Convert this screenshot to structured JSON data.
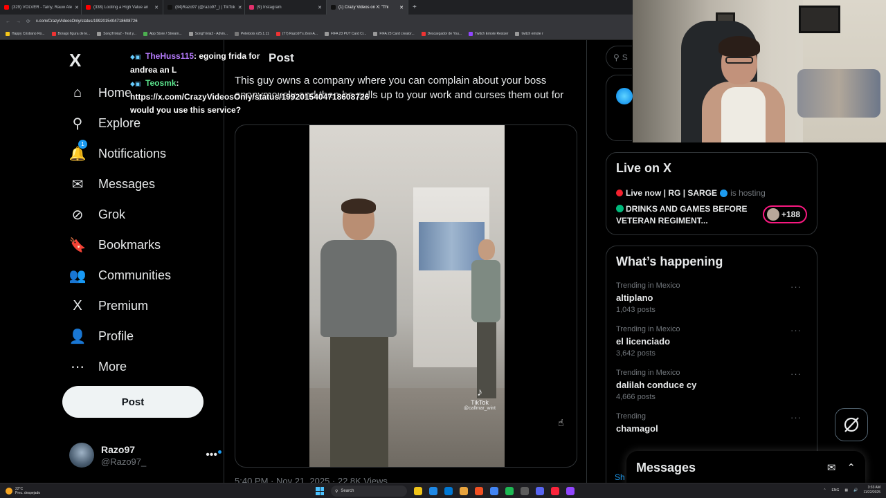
{
  "browser": {
    "tabs": [
      {
        "label": "(329) VOLVER - Tainy, Rauw Ale",
        "color": "#ff0000",
        "active": false
      },
      {
        "label": "(338) Looting a High Value an",
        "color": "#ff0000",
        "active": false
      },
      {
        "label": "(84)Razo97 (@razo97_) | TikTok",
        "color": "#111111",
        "active": false
      },
      {
        "label": "(9) Instagram",
        "color": "#e1306c",
        "active": false
      },
      {
        "label": "(1) Crazy Videos on X: \"Thi",
        "color": "#111111",
        "active": true
      }
    ],
    "url": "x.com/CrazyVideosOnly/status/1992015404718608726",
    "bookmarks": [
      {
        "label": "Happy Cristiano Ro...",
        "color": "#f5c518"
      },
      {
        "label": "Borago figura de te...",
        "color": "#e33"
      },
      {
        "label": "SongTrivia2 - Test y...",
        "color": "#999"
      },
      {
        "label": "App Store / Stream...",
        "color": "#4caf50"
      },
      {
        "label": "SongTrivia2 - Advin...",
        "color": "#999"
      },
      {
        "label": "Peletools v25.1.11",
        "color": "#777"
      },
      {
        "label": "(77) Razo97's Zest-A...",
        "color": "#e33"
      },
      {
        "label": "FIFA 23 PUT Card Cr...",
        "color": "#999"
      },
      {
        "label": "FIFA 23 Card creator...",
        "color": "#999"
      },
      {
        "label": "Descargador de You...",
        "color": "#e33"
      },
      {
        "label": "Twitch Emote Resizer",
        "color": "#9146ff"
      },
      {
        "label": "twitch emote r",
        "color": "#999"
      }
    ]
  },
  "nav": {
    "logo": "X",
    "items": [
      {
        "label": "Home",
        "icon": "home-icon",
        "glyph": "⌂"
      },
      {
        "label": "Explore",
        "icon": "search-icon",
        "glyph": "⚲"
      },
      {
        "label": "Notifications",
        "icon": "bell-icon",
        "glyph": "🔔",
        "badge": "1"
      },
      {
        "label": "Messages",
        "icon": "envelope-icon",
        "glyph": "✉"
      },
      {
        "label": "Grok",
        "icon": "grok-icon",
        "glyph": "⊘"
      },
      {
        "label": "Bookmarks",
        "icon": "bookmark-icon",
        "glyph": "🔖"
      },
      {
        "label": "Communities",
        "icon": "communities-icon",
        "glyph": "👥"
      },
      {
        "label": "Premium",
        "icon": "x-premium-icon",
        "glyph": "X"
      },
      {
        "label": "Profile",
        "icon": "person-icon",
        "glyph": "👤"
      },
      {
        "label": "More",
        "icon": "more-circle-icon",
        "glyph": "⋯"
      }
    ],
    "post_button": "Post",
    "account": {
      "name": "Razo97",
      "handle": "@Razo97_",
      "more": "•••"
    }
  },
  "center": {
    "title": "Post",
    "text": "This guy owns a company where you can complain about your boss anonymously and then he pulls up to your work and curses them out for",
    "video_watermark": "TikTok",
    "video_handle": "@callmar_wint",
    "meta": "5:40 PM · Nov 21, 2025 · 22.8K Views"
  },
  "right": {
    "search_placeholder": "S",
    "live": {
      "title": "Live on X",
      "host_prefix": "Live now | RG | SARGE",
      "host_suffix": "is hosting",
      "space_title": "DRINKS AND GAMES BEFORE VETERAN REGIMENT...",
      "listeners": "+188"
    },
    "happening": {
      "title": "What’s happening",
      "trends": [
        {
          "context": "Trending in Mexico",
          "name": "altiplano",
          "count": "1,043 posts"
        },
        {
          "context": "Trending in Mexico",
          "name": "el licenciado",
          "count": "3,642 posts"
        },
        {
          "context": "Trending in Mexico",
          "name": "dalilah conduce cy",
          "count": "4,666 posts"
        },
        {
          "context": "Trending",
          "name": "chamagol",
          "count": ""
        }
      ],
      "trend_more": "···",
      "show_more": "Sh"
    },
    "messages_drawer": {
      "title": "Messages"
    }
  },
  "chat_overlay": {
    "messages": [
      {
        "user": "TheHuss115",
        "text": ": egoing frida for andrea an L"
      },
      {
        "user": "Teosmk",
        "text": ": https://x.com/CrazyVideosOnly/status/1992015404718608726 would you use this service?"
      }
    ]
  },
  "taskbar": {
    "weather_temp": "22°C",
    "weather_desc": "Prec. despejado",
    "search_label": "Search",
    "language": "ENG",
    "time": "3:33 AM",
    "date": "11/22/2025",
    "apps": [
      "#f0c419",
      "#1e88e5",
      "#0078d4",
      "#e8a33d",
      "#f25022",
      "#4285f4",
      "#1db954",
      "#5c5c5c",
      "#5865f2",
      "#fa243c",
      "#9146ff"
    ]
  }
}
